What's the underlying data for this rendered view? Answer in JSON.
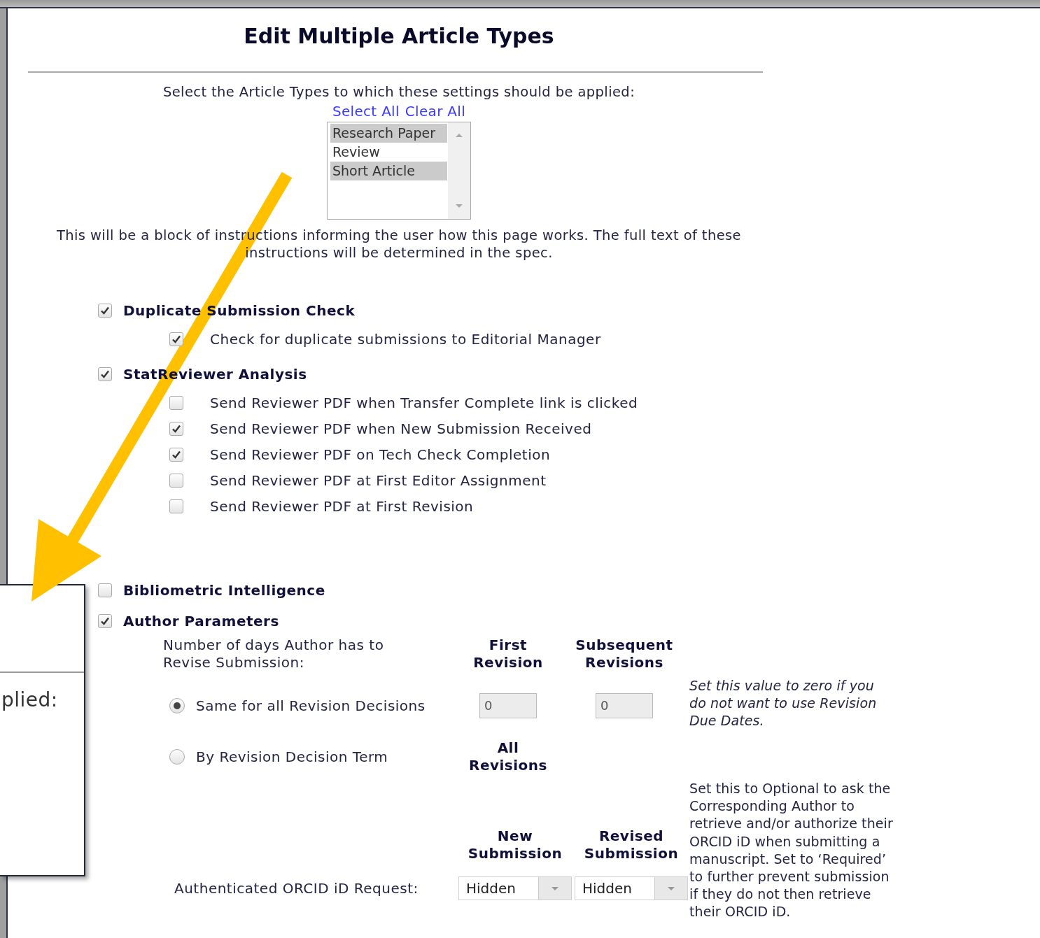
{
  "title": "Edit Multiple Article Types",
  "article_types": {
    "prompt": "Select the Article Types to which these settings should be applied:",
    "links": [
      "Select All",
      "Clear All"
    ],
    "items": [
      {
        "label": "Research Paper",
        "selected": true
      },
      {
        "label": "Review",
        "selected": false
      },
      {
        "label": "Short Article",
        "selected": true
      }
    ]
  },
  "instructions": "This will be a block of instructions informing the user how this page works. The full text of these instructions will be determined in the spec.",
  "sections": [
    {
      "label": "Duplicate Submission Check",
      "checked": true,
      "options": [
        {
          "label": "Check for duplicate submissions to Editorial Manager",
          "checked": true
        }
      ]
    },
    {
      "label": "StatReviewer Analysis",
      "checked": true,
      "options": [
        {
          "label": "Send Reviewer PDF when Transfer Complete link is clicked",
          "checked": false
        },
        {
          "label": "Send Reviewer PDF when New Submission Received",
          "checked": true
        },
        {
          "label": "Send Reviewer PDF on Tech Check Completion",
          "checked": true
        },
        {
          "label": "Send Reviewer PDF at First Editor Assignment",
          "checked": false
        },
        {
          "label": "Send Reviewer PDF at First Revision",
          "checked": false
        }
      ]
    },
    {
      "label": "Bibliometric Intelligence",
      "checked": false
    }
  ],
  "author_parameters": {
    "label": "Author Parameters",
    "checked": true,
    "days_label": "Number of days Author has to Revise Submission:",
    "column_headers": [
      "First Revision",
      "Subsequent Revisions"
    ],
    "modes": [
      {
        "label": "Same for all Revision Decisions",
        "selected": true
      },
      {
        "label": "By Revision Decision Term",
        "selected": false
      }
    ],
    "values": [
      "0",
      "0"
    ],
    "days_note": "Set this value to zero if you do not want to use Revision Due Dates.",
    "all_revisions_header": "All Revisions",
    "orcid": {
      "headers": [
        "New Submission",
        "Revised Submission"
      ],
      "label": "Authenticated ORCID iD Request:",
      "values": [
        "Hidden",
        "Hidden"
      ],
      "note": "Set this to Optional to ask the Corresponding Author to retrieve and/or authorize their ORCID iD when submitting a manuscript. Set to ‘Required’ to further prevent submission if they do not then retrieve their ORCID iD."
    }
  },
  "callout": {
    "text": "plied:"
  }
}
